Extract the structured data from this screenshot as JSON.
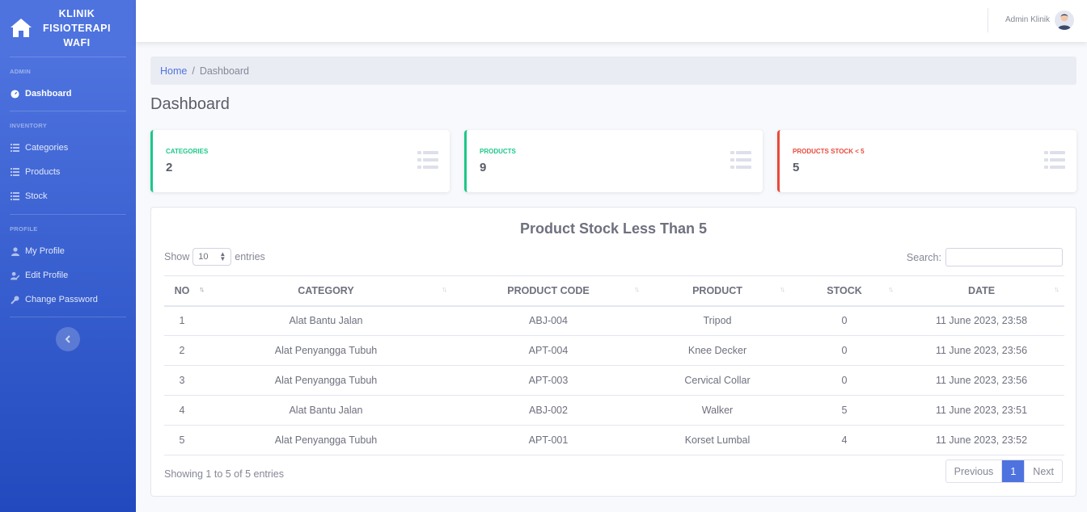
{
  "brand": {
    "line1": "KLINIK",
    "line2": "FISIOTERAPI",
    "line3": "WAFI"
  },
  "sidebar": {
    "sections": [
      {
        "heading": "ADMIN",
        "items": [
          {
            "label": "Dashboard",
            "icon": "dashboard-icon",
            "active": true
          }
        ]
      },
      {
        "heading": "INVENTORY",
        "items": [
          {
            "label": "Categories",
            "icon": "list-icon"
          },
          {
            "label": "Products",
            "icon": "list-icon"
          },
          {
            "label": "Stock",
            "icon": "list-icon"
          }
        ]
      },
      {
        "heading": "PROFILE",
        "items": [
          {
            "label": "My Profile",
            "icon": "user-icon"
          },
          {
            "label": "Edit Profile",
            "icon": "user-edit-icon"
          },
          {
            "label": "Change Password",
            "icon": "key-icon"
          }
        ]
      }
    ]
  },
  "topbar": {
    "user_name": "Admin Klinik"
  },
  "breadcrumb": {
    "home": "Home",
    "separator": "/",
    "current": "Dashboard"
  },
  "page_title": "Dashboard",
  "cards": [
    {
      "label": "CATEGORIES",
      "value": "2",
      "color": "#1cc88a"
    },
    {
      "label": "PRODUCTS",
      "value": "9",
      "color": "#1cc88a"
    },
    {
      "label": "PRODUCTS STOCK < 5",
      "value": "5",
      "color": "#e74a3b"
    }
  ],
  "table": {
    "title": "Product Stock Less Than 5",
    "show_label": "Show",
    "entries_label": "entries",
    "page_size": "10",
    "search_label": "Search:",
    "columns": [
      "NO",
      "CATEGORY",
      "PRODUCT CODE",
      "PRODUCT",
      "STOCK",
      "DATE"
    ],
    "rows": [
      [
        "1",
        "Alat Bantu Jalan",
        "ABJ-004",
        "Tripod",
        "0",
        "11 June 2023, 23:58"
      ],
      [
        "2",
        "Alat Penyangga Tubuh",
        "APT-004",
        "Knee Decker",
        "0",
        "11 June 2023, 23:56"
      ],
      [
        "3",
        "Alat Penyangga Tubuh",
        "APT-003",
        "Cervical Collar",
        "0",
        "11 June 2023, 23:56"
      ],
      [
        "4",
        "Alat Bantu Jalan",
        "ABJ-002",
        "Walker",
        "5",
        "11 June 2023, 23:51"
      ],
      [
        "5",
        "Alat Penyangga Tubuh",
        "APT-001",
        "Korset Lumbal",
        "4",
        "11 June 2023, 23:52"
      ]
    ],
    "showing": "Showing 1 to 5 of 5 entries",
    "pager": {
      "prev": "Previous",
      "current": "1",
      "next": "Next"
    }
  }
}
